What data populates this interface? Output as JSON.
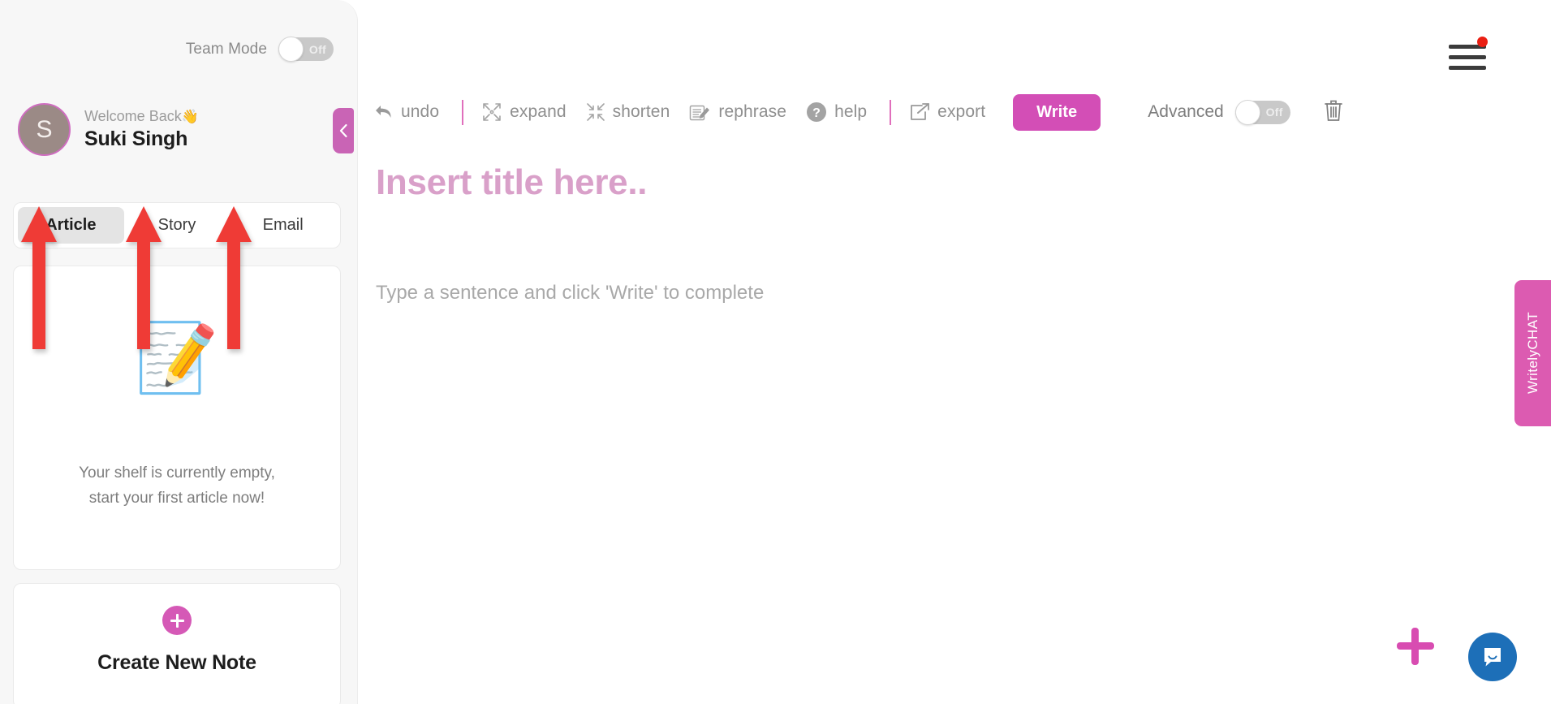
{
  "sidebar": {
    "team_mode": {
      "label": "Team Mode",
      "state": "Off",
      "enabled": false
    },
    "profile": {
      "welcome": "Welcome Back",
      "wave_emoji": "👋",
      "name": "Suki Singh",
      "initial": "S"
    },
    "tabs": [
      {
        "label": "Article",
        "active": true
      },
      {
        "label": "Story",
        "active": false
      },
      {
        "label": "Email",
        "active": false
      }
    ],
    "shelf": {
      "emoji": "📝",
      "empty_line1": "Your shelf is currently empty,",
      "empty_line2": "start your first article now!"
    },
    "new_note": {
      "label": "Create New Note",
      "icon": "plus-circle-icon"
    },
    "collapse_icon": "chevron-left-icon"
  },
  "header": {
    "menu_icon": "hamburger-menu-icon",
    "has_notification": true,
    "notification_color": "#ea1f13"
  },
  "toolbar": {
    "undo": {
      "label": "undo",
      "icon": "undo-arrow-icon"
    },
    "expand": {
      "label": "expand",
      "icon": "expand-arrows-icon"
    },
    "shorten": {
      "label": "shorten",
      "icon": "shorten-arrows-icon"
    },
    "rephrase": {
      "label": "rephrase",
      "icon": "pencil-document-icon"
    },
    "help": {
      "label": "help",
      "icon": "question-circle-icon"
    },
    "export": {
      "label": "export",
      "icon": "share-export-icon"
    },
    "write": {
      "label": "Write",
      "color": "#d34eb6"
    },
    "advanced": {
      "label": "Advanced",
      "state": "Off",
      "enabled": false
    },
    "delete": {
      "icon": "trash-icon"
    }
  },
  "editor": {
    "title_placeholder": "Insert title here..",
    "body_placeholder": "Type a sentence and click 'Write' to complete"
  },
  "chat": {
    "side_tab_label": "WritelyCHAT",
    "launcher_icon": "intercom-chat-icon",
    "launcher_color": "#1d6fb8"
  },
  "fab": {
    "icon": "plus-icon",
    "color": "#d84cb1"
  },
  "annotations": {
    "arrow_color": "#ef3b36",
    "arrows": [
      {
        "target": "tab-article"
      },
      {
        "target": "tab-story"
      },
      {
        "target": "tab-email"
      }
    ]
  }
}
